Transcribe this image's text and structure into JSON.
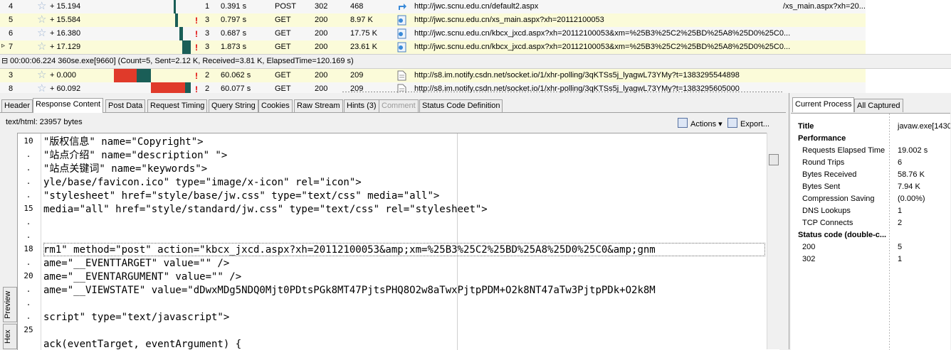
{
  "sessions_before": [
    {
      "num": "4",
      "delta": "+ 15.194",
      "warn": "",
      "rt": "1",
      "elapsed": "0.391 s",
      "method": "POST",
      "status": "302",
      "size": "468",
      "url": "http://jwc.scnu.edu.cn/default2.aspx",
      "extra": "/xs_main.aspx?xh=20...",
      "icon": "redirect-icon"
    },
    {
      "num": "5",
      "delta": "+ 15.584",
      "warn": "!",
      "rt": "3",
      "elapsed": "0.797 s",
      "method": "GET",
      "status": "200",
      "size": "8.97 K",
      "url": "http://jwc.scnu.edu.cn/xs_main.aspx?xh=20112100053",
      "extra": "",
      "icon": "page-icon"
    },
    {
      "num": "6",
      "delta": "+ 16.380",
      "warn": "!",
      "rt": "3",
      "elapsed": "0.687 s",
      "method": "GET",
      "status": "200",
      "size": "17.75 K",
      "url": "http://jwc.scnu.edu.cn/kbcx_jxcd.aspx?xh=20112100053&xm=%25B3%25C2%25BD%25A8%25D0%25C0...",
      "extra": "",
      "icon": "page-icon"
    },
    {
      "num": "7",
      "delta": "+ 17.129",
      "warn": "!",
      "rt": "3",
      "elapsed": "1.873 s",
      "method": "GET",
      "status": "200",
      "size": "23.61 K",
      "url": "http://jwc.scnu.edu.cn/kbcx_jxcd.aspx?xh=20112100053&xm=%25B3%25C2%25BD%25A8%25D0%25C0...",
      "extra": "",
      "icon": "page-icon"
    }
  ],
  "group": {
    "label": "00:00:06.224   360se.exe[9660]  (Count=5, Sent=2.12 K, Received=3.81 K, ElapsedTime=120.169 s)"
  },
  "sessions_after": [
    {
      "num": "3",
      "delta": "+ 0.000",
      "warn": "!",
      "rt": "2",
      "elapsed": "60.062 s",
      "method": "GET",
      "status": "200",
      "size": "209",
      "url": "http://s8.im.notify.csdn.net/socket.io/1/xhr-polling/3qKTSs5j_lyagwL73YMy?t=1383295544898",
      "extra": "",
      "icon": "doc-icon"
    },
    {
      "num": "8",
      "delta": "+ 60.092",
      "warn": "!",
      "rt": "2",
      "elapsed": "60.077 s",
      "method": "GET",
      "status": "200",
      "size": "209",
      "url": "http://s8.im.notify.csdn.net/socket.io/1/xhr-polling/3qKTSs5j_lyagwL73YMy?t=1383295605000",
      "extra": "",
      "icon": "doc-icon"
    }
  ],
  "inspector_tabs": [
    "Header",
    "Response Content",
    "Post Data",
    "Request Timing",
    "Query String",
    "Cookies",
    "Raw Stream",
    "Hints (3)",
    "Comment",
    "Status Code Definition"
  ],
  "content_type": "text/html: 23957 bytes",
  "actions_label": "Actions",
  "export_label": "Export...",
  "line_numbers": [
    "10",
    ".",
    ".",
    ".",
    ".",
    "15",
    ".",
    ".",
    "18",
    ".",
    "20",
    ".",
    ".",
    ".",
    "25"
  ],
  "code_lines": [
    "\"版权信息\" name=\"Copyright\">",
    "\"站点介绍\" name=\"description\" \">",
    "\"站点关键词\" name=\"keywords\">",
    "yle/base/favicon.ico\" type=\"image/x-icon\" rel=\"icon\">",
    "\"stylesheet\" href=\"style/base/jw.css\" type=\"text/css\" media=\"all\">",
    "media=\"all\" href=\"style/standard/jw.css\" type=\"text/css\" rel=\"stylesheet\">",
    "",
    "",
    "rm1\" method=\"post\" action=\"kbcx_jxcd.aspx?xh=20112100053&amp;xm=%25B3%25C2%25BD%25A8%25D0%25C0&amp;gnm",
    "ame=\"__EVENTTARGET\" value=\"\" />",
    "ame=\"__EVENTARGUMENT\" value=\"\" />",
    "ame=\"__VIEWSTATE\" value=\"dDwxMDg5NDQ0Mjt0PDtsPGk8MT47PjtsPHQ8O2w8aTwxPjtpPDM+O2k8NT47aTw3PjtpPDk+O2k8M",
    "",
    "script\" type=\"text/javascript\">",
    "",
    "ack(eventTarget, eventArgument) {"
  ],
  "side_tabs": [
    "Preview",
    "Hex"
  ],
  "right_tabs": [
    "Current Process",
    "All Captured"
  ],
  "process_title_key": "Title",
  "process_title_value": "javaw.exe[1430",
  "perf_header": "Performance",
  "perf": [
    {
      "k": "Requests Elapsed Time",
      "v": "19.002 s"
    },
    {
      "k": "Round Trips",
      "v": "6"
    },
    {
      "k": "Bytes Received",
      "v": "58.76 K"
    },
    {
      "k": "Bytes Sent",
      "v": "7.94 K"
    },
    {
      "k": "Compression Saving",
      "v": " (0.00%)"
    },
    {
      "k": "DNS Lookups",
      "v": "1"
    },
    {
      "k": "TCP Connects",
      "v": "2"
    }
  ],
  "status_header": "Status code (double-c...",
  "status_codes": [
    {
      "k": "200",
      "v": "5"
    },
    {
      "k": "302",
      "v": "1"
    }
  ],
  "colors": {
    "accent_red": "#e03a2a",
    "timeline_teal": "#1a5e57",
    "warn": "#e00000"
  }
}
